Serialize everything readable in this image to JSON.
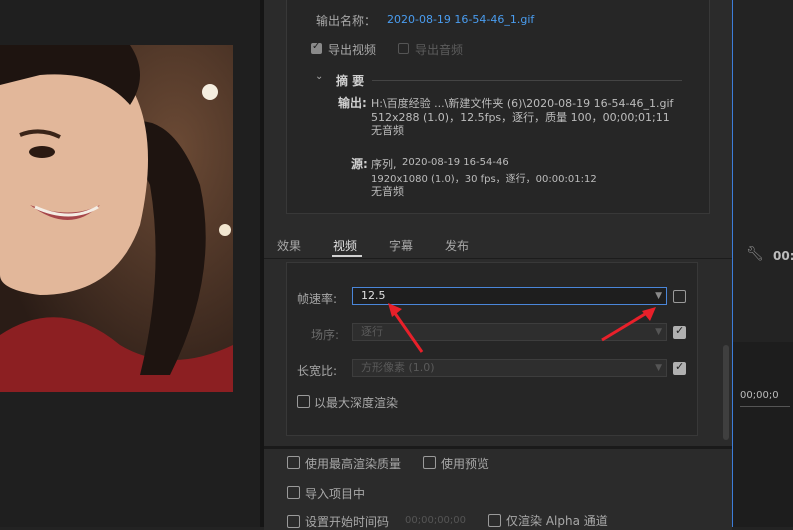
{
  "export": {
    "output_name_label": "输出名称：",
    "output_name_value": "2020-08-19 16-54-46_1.gif",
    "export_video_label": "导出视频",
    "export_audio_label": "导出音频",
    "summary_title": "摘 要",
    "output_label": "输出:",
    "output_path": "H:\\百度经验 ...\\新建文件夹 (6)\\2020-08-19  16-54-46_1.gif",
    "output_spec": "512x288 (1.0)，12.5fps，逐行，质量 100，00;00;01;11",
    "output_audio": "无音频",
    "source_label": "源:",
    "source_name": "序列,",
    "source_seq": "2020-08-19 16-54-46",
    "source_spec": "1920x1080 (1.0)，30 fps，逐行，00:00:01:12",
    "source_audio": "无音频"
  },
  "tabs": [
    {
      "label": "效果"
    },
    {
      "label": "视频"
    },
    {
      "label": "字幕"
    },
    {
      "label": "发布"
    }
  ],
  "video": {
    "frame_rate_label": "帧速率:",
    "frame_rate_value": "12.5",
    "field_order_label": "场序:",
    "field_order_value": "逐行",
    "aspect_label": "长宽比:",
    "aspect_value": "方形像素 (1.0)",
    "max_depth_label": "以最大深度渲染"
  },
  "bottom": {
    "max_quality_label": "使用最高渲染质量",
    "use_previews_label": "使用预览",
    "import_label": "导入项目中",
    "set_start_label": "设置开始时间码",
    "start_tc": "00;00;00;00",
    "alpha_label": "仅渲染 Alpha 通道"
  },
  "right": {
    "tc_top": "00:",
    "tc_ruler": "00;00;0"
  },
  "colors": {
    "accent": "#4a86d9",
    "link": "#4a9df0",
    "arrow": "#e8202a"
  }
}
